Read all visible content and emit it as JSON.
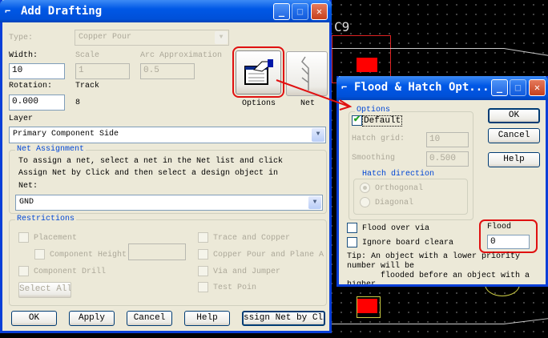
{
  "background": {
    "designator": "C9"
  },
  "add_drafting": {
    "title": "Add Drafting",
    "type_label": "Type:",
    "type_value": "Copper Pour",
    "width_label": "Width:",
    "width_value": "10",
    "scale_label": "Scale",
    "scale_value": "1",
    "arc_label": "Arc Approximation",
    "arc_value": "0.5",
    "rotation_label": "Rotation:",
    "rotation_value": "0.000",
    "track_label": "Track",
    "track_value": "8",
    "options_label": "Options",
    "net_label": "Net",
    "layer_label": "Layer",
    "layer_value": "Primary Component Side",
    "net_assignment": {
      "title": "Net Assignment",
      "line1": "To assign a net, select a net in the Net list and click",
      "line2": "Assign Net by Click and then select a design object in",
      "net_field_label": "Net:",
      "net_value": "GND"
    },
    "restrictions": {
      "title": "Restrictions",
      "placement": "Placement",
      "component_height": "Component Height",
      "component_drill": "Component Drill",
      "select_all": "Select All",
      "trace_copper": "Trace and Copper",
      "copper_pour_plane": "Copper Pour and Plane A",
      "via_jumper": "Via and Jumper",
      "test_point": "Test Poin"
    },
    "buttons": {
      "ok": "OK",
      "apply": "Apply",
      "cancel": "Cancel",
      "help": "Help",
      "assign": "ssign Net by Clic"
    }
  },
  "flood_hatch": {
    "title": "Flood & Hatch Opt...",
    "options_title": "Options",
    "default_label": "Default",
    "default_checked": true,
    "hatch_grid_label": "Hatch grid:",
    "hatch_grid_value": "10",
    "smoothing_label": "Smoothing",
    "smoothing_value": "0.500",
    "hatch_direction_title": "Hatch direction",
    "orthogonal": "Orthogonal",
    "diagonal": "Diagonal",
    "ok": "OK",
    "cancel": "Cancel",
    "help": "Help",
    "flood_over_via": "Flood over via",
    "ignore_board": "Ignore board cleara",
    "flood_label": "Flood",
    "flood_value": "0",
    "tip1": "Tip: An object with a lower priority",
    "tip2": "number will be",
    "tip3": "flooded before an object with a",
    "tip4": "higher"
  },
  "colors": {
    "highlight": "#e01010",
    "titlebar": "#0058e6",
    "dialog": "#ece9d8"
  }
}
